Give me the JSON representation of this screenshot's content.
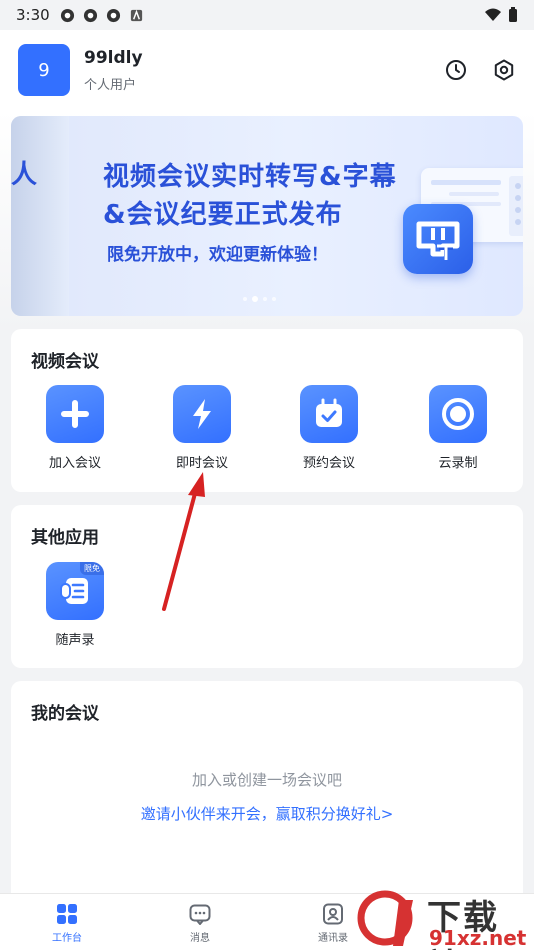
{
  "status_bar": {
    "time": "3:30"
  },
  "header": {
    "avatar_text": "9",
    "username": "99ldly",
    "user_type": "个人用户"
  },
  "banner": {
    "fragment": "人",
    "title_line1": "视频会议实时转写&字幕",
    "title_line2": "&会议纪要正式发布",
    "subtitle": "限免开放中，欢迎更新体验！"
  },
  "video_meeting": {
    "title": "视频会议",
    "items": [
      {
        "label": "加入会议",
        "icon": "plus-icon"
      },
      {
        "label": "即时会议",
        "icon": "lightning-icon"
      },
      {
        "label": "预约会议",
        "icon": "calendar-check-icon"
      },
      {
        "label": "云录制",
        "icon": "record-icon"
      }
    ]
  },
  "other_apps": {
    "title": "其他应用",
    "items": [
      {
        "label": "随声录",
        "badge": "限免",
        "icon": "voice-note-icon"
      }
    ]
  },
  "my_meetings": {
    "title": "我的会议",
    "empty_text": "加入或创建一场会议吧",
    "invite_link": "邀请小伙伴来开会，赢取积分换好礼>"
  },
  "tabbar": {
    "items": [
      {
        "label": "工作台",
        "active": true,
        "icon": "grid-icon"
      },
      {
        "label": "消息",
        "active": false,
        "icon": "chat-icon"
      },
      {
        "label": "通讯录",
        "active": false,
        "icon": "contacts-icon"
      }
    ]
  },
  "watermark": {
    "text": "下载站",
    "url": "91xz.net"
  },
  "colors": {
    "accent": "#3370ff",
    "banner_text": "#2a51d8",
    "arrow": "#d62222"
  }
}
